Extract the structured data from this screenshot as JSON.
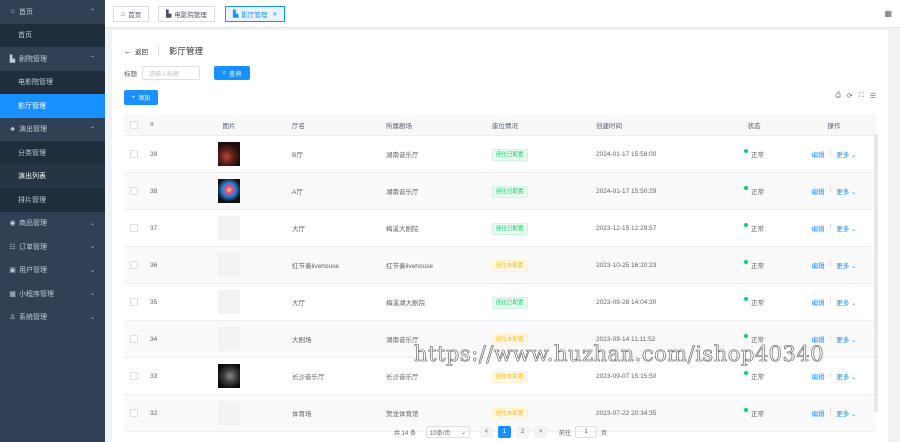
{
  "sidebar": {
    "items": [
      {
        "label": "首页",
        "icon": "home-icon",
        "kind": "group",
        "arrow": "^"
      },
      {
        "label": "首页",
        "kind": "sub"
      },
      {
        "label": "剧院管理",
        "icon": "theater-icon",
        "kind": "group",
        "arrow": "^"
      },
      {
        "label": "电影院管理",
        "kind": "sub"
      },
      {
        "label": "影厅管理",
        "kind": "sub",
        "active": true
      },
      {
        "label": "演出管理",
        "icon": "show-icon",
        "kind": "group",
        "arrow": "^"
      },
      {
        "label": "分类管理",
        "kind": "sub"
      },
      {
        "label": "演出列表",
        "kind": "sub",
        "hover": true
      },
      {
        "label": "排片管理",
        "kind": "sub"
      },
      {
        "label": "商品管理",
        "icon": "goods-icon",
        "kind": "group",
        "arrow": "v"
      },
      {
        "label": "订单管理",
        "icon": "order-icon",
        "kind": "group",
        "arrow": "v"
      },
      {
        "label": "用户管理",
        "icon": "user-icon",
        "kind": "group",
        "arrow": "v"
      },
      {
        "label": "小程序管理",
        "icon": "miniapp-icon",
        "kind": "group",
        "arrow": "v"
      },
      {
        "label": "系统管理",
        "icon": "system-icon",
        "kind": "group",
        "arrow": "v"
      }
    ]
  },
  "tabs": {
    "home": "首页",
    "cinema": "电影院管理",
    "hall": "影厅管理"
  },
  "header": {
    "back": "返回",
    "title": "影厅管理"
  },
  "search": {
    "label": "标题",
    "placeholder": "请输入标题",
    "button": "查询"
  },
  "add_button": "添加",
  "table": {
    "columns": {
      "id": "#",
      "image": "图片",
      "name": "厅名",
      "venue": "所属剧场",
      "seat": "座位情况",
      "created": "创建时间",
      "status": "状态",
      "op": "操作"
    },
    "rows": [
      {
        "id": "39",
        "img": "photo1",
        "name": "B厅",
        "venue": "湖南音乐厅",
        "seat": "座位已配置",
        "seat_color": "green",
        "created": "2024-01-17 15:58:00",
        "status": "正常",
        "edit": "编辑",
        "more": "更多"
      },
      {
        "id": "38",
        "img": "photo2",
        "name": "A厅",
        "venue": "湖南音乐厅",
        "seat": "座位已配置",
        "seat_color": "green",
        "created": "2024-01-17 15:50:29",
        "status": "正常",
        "edit": "编辑",
        "more": "更多"
      },
      {
        "id": "37",
        "img": "blank",
        "name": "大厅",
        "venue": "梅溪大剧院",
        "seat": "座位已配置",
        "seat_color": "green",
        "created": "2023-12-15 12:29:57",
        "status": "正常",
        "edit": "编辑",
        "more": "更多"
      },
      {
        "id": "36",
        "img": "blank",
        "name": "红节奏livehouse",
        "venue": "红节奏livehouse",
        "seat": "座位未配置",
        "seat_color": "orange",
        "created": "2023-10-25 16:20:23",
        "status": "正常",
        "edit": "编辑",
        "more": "更多"
      },
      {
        "id": "35",
        "img": "blank",
        "name": "大厅",
        "venue": "梅溪湖大剧院",
        "seat": "座位已配置",
        "seat_color": "green",
        "created": "2023-09-28 14:04:30",
        "status": "正常",
        "edit": "编辑",
        "more": "更多"
      },
      {
        "id": "34",
        "img": "blank",
        "name": "大剧场",
        "venue": "湖南音乐厅",
        "seat": "座位未配置",
        "seat_color": "orange",
        "created": "2023-09-14 11:11:52",
        "status": "正常",
        "edit": "编辑",
        "more": "更多"
      },
      {
        "id": "33",
        "img": "photo3",
        "name": "长沙音乐厅",
        "venue": "长沙音乐厅",
        "seat": "座位未配置",
        "seat_color": "orange",
        "created": "2023-09-07 15:15:50",
        "status": "正常",
        "edit": "编辑",
        "more": "更多"
      },
      {
        "id": "32",
        "img": "blank",
        "name": "体育场",
        "venue": "贺龙体育馆",
        "seat": "座位未配置",
        "seat_color": "orange",
        "created": "2023-07-22 20:34:35",
        "status": "正常",
        "edit": "编辑",
        "more": "更多"
      }
    ]
  },
  "pager": {
    "total": "共 14 条",
    "size": "10条/页",
    "prev": "<",
    "pages": [
      "1",
      "2"
    ],
    "next": ">",
    "goto_label": "前往",
    "goto_value": "1",
    "goto_suffix": "页"
  },
  "watermark": "https://www.huzhan.com/ishop40340",
  "colors": {
    "primary": "#1890ff",
    "sidebar": "#304156",
    "success": "#13ce66",
    "warning": "#ffba00"
  }
}
